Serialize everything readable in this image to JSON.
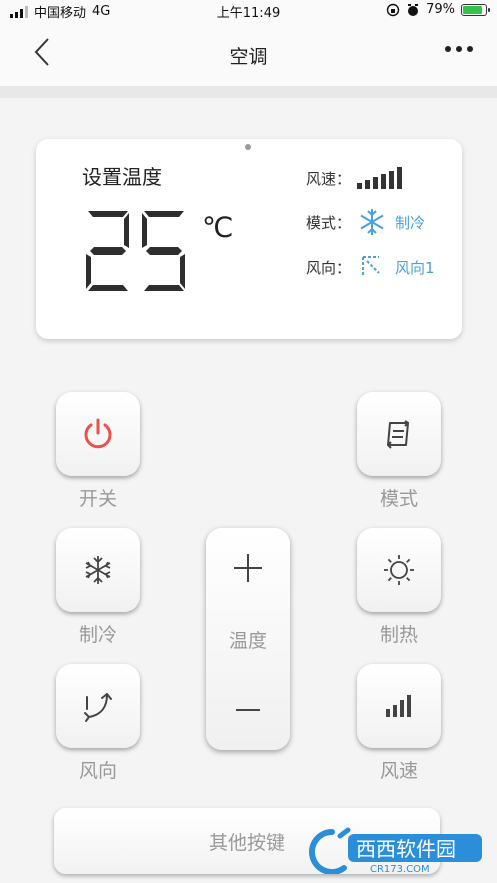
{
  "status_bar": {
    "carrier": "中国移动",
    "network": "4G",
    "time": "上午11:49",
    "battery": "79%"
  },
  "nav": {
    "title": "空调"
  },
  "display": {
    "set_temp_label": "设置温度",
    "temperature": "25",
    "unit": "℃",
    "fan_speed_label": "风速：",
    "mode_label": "模式：",
    "mode_value": "制冷",
    "direction_label": "风向：",
    "direction_value": "风向1",
    "fan_speed_level": 6
  },
  "buttons": {
    "power": "开关",
    "mode": "模式",
    "cool": "制冷",
    "heat": "制热",
    "direction": "风向",
    "speed": "风速",
    "temperature": "温度",
    "other": "其他按键"
  },
  "watermark": {
    "brand": "西西软件园",
    "site": "CR173.COM"
  },
  "colors": {
    "accent_blue": "#4aa0e0",
    "power_red": "#e9514a",
    "label_gray": "#999999"
  }
}
